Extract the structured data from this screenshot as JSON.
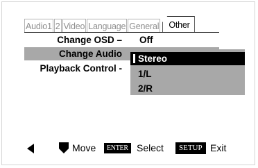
{
  "tabs": [
    {
      "label": "Audio1"
    },
    {
      "label": "2"
    },
    {
      "label": "Video"
    },
    {
      "label": "Language"
    },
    {
      "label": "General"
    },
    {
      "label": "Other"
    }
  ],
  "menu": {
    "rows": [
      {
        "label": "Change OSD –",
        "value": "Off"
      },
      {
        "label": "Change Audio",
        "value": ""
      },
      {
        "label": "Playback Control -",
        "value": ""
      }
    ]
  },
  "dropdown": {
    "options": [
      {
        "label": "Stereo",
        "selected": true
      },
      {
        "label": "1/L",
        "selected": false
      },
      {
        "label": "2/R",
        "selected": false
      }
    ]
  },
  "footer": {
    "left_arrow_icon": "left-arrow-icon",
    "down_icon": "down-pointer-icon",
    "move_label": "Move",
    "enter_key": "ENTER",
    "select_label": "Select",
    "setup_key": "SETUP",
    "exit_label": "Exit"
  },
  "colors": {
    "highlight": "#a8a8a8",
    "selected_bg": "#000000",
    "inactive_tab_text": "#8e8e8e"
  }
}
